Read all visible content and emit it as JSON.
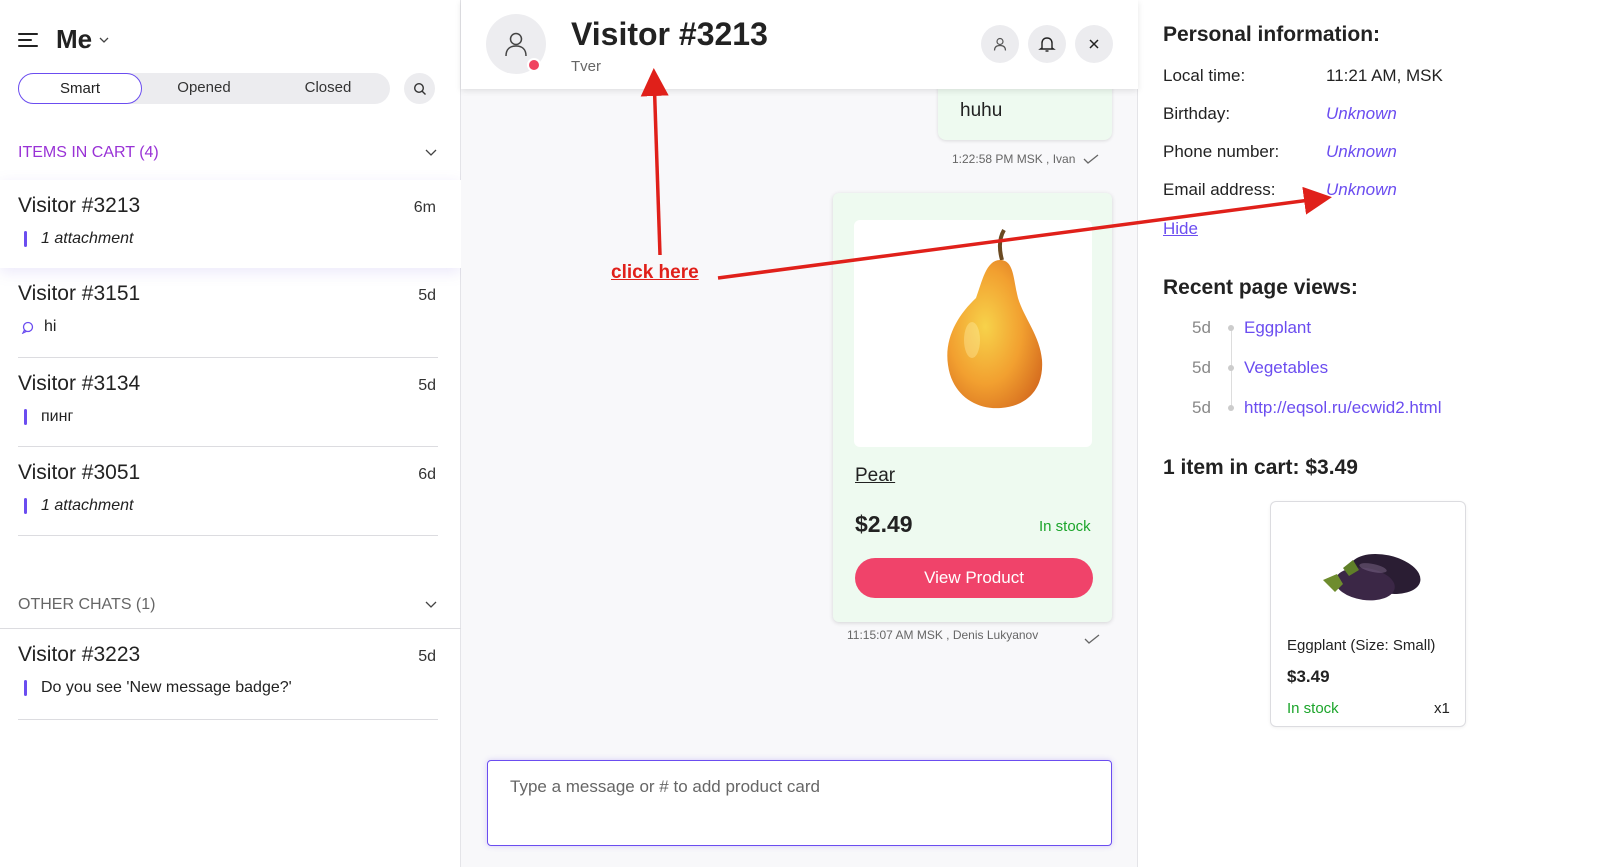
{
  "sidebar": {
    "title": "Me",
    "filters": [
      "Smart",
      "Opened",
      "Closed"
    ],
    "cart_section": "ITEMS IN CART (4)",
    "other_section": "OTHER CHATS (1)",
    "cart_chats": [
      {
        "name": "Visitor #3213",
        "time": "6m",
        "preview": "1 attachment"
      },
      {
        "name": "Visitor #3151",
        "time": "5d",
        "preview": "hi"
      },
      {
        "name": "Visitor #3134",
        "time": "5d",
        "preview": "пинг"
      },
      {
        "name": "Visitor #3051",
        "time": "6d",
        "preview": "1 attachment"
      }
    ],
    "other_chats": [
      {
        "name": "Visitor #3223",
        "time": "5d",
        "preview": "Do you see 'New message badge?'"
      }
    ]
  },
  "chat": {
    "title": "Visitor #3213",
    "location": "Tver",
    "message_text": "huhu",
    "message_meta": "1:22:58 PM MSK , Ivan",
    "product": {
      "name": "Pear",
      "price": "$2.49",
      "stock": "In stock",
      "button": "View Product"
    },
    "product_meta": "11:15:07 AM MSK , Denis Lukyanov",
    "composer_placeholder": "Type a message or # to add product card"
  },
  "info": {
    "heading": "Personal information:",
    "rows": [
      {
        "label": "Local time:",
        "value": "11:21 AM, MSK"
      },
      {
        "label": "Birthday:",
        "value": "Unknown"
      },
      {
        "label": "Phone number:",
        "value": "Unknown"
      },
      {
        "label": "Email address:",
        "value": "Unknown"
      }
    ],
    "hide": "Hide",
    "page_views_heading": "Recent page views:",
    "page_views": [
      {
        "age": "5d",
        "title": "Eggplant"
      },
      {
        "age": "5d",
        "title": "Vegetables"
      },
      {
        "age": "5d",
        "title": "http://eqsol.ru/ecwid2.html"
      }
    ],
    "cart_heading": "1 item in cart: $3.49",
    "cart_item": {
      "name": "Eggplant (Size: Small)",
      "price": "$3.49",
      "stock": "In stock",
      "qty": "x1"
    }
  },
  "annotation": {
    "text": "click here",
    "color": "#e0201a"
  },
  "colors": {
    "accent": "#6b4df0",
    "cart_section": "#9932d6",
    "cta": "#f0436a",
    "in_stock": "#1ca52b",
    "status_dot": "#f0435f"
  }
}
